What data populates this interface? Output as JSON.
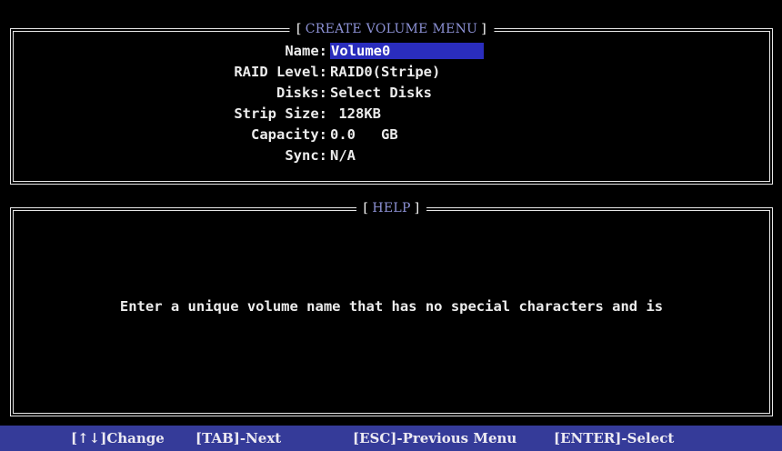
{
  "create_panel": {
    "title": "CREATE VOLUME MENU",
    "fields": [
      {
        "label": "Name:",
        "value": "Volume0"
      },
      {
        "label": "RAID Level:",
        "value": "RAID0(Stripe)"
      },
      {
        "label": "Disks:",
        "value": "Select Disks"
      },
      {
        "label": "Strip Size:",
        "value": " 128KB"
      },
      {
        "label": "Capacity:",
        "value": "0.0   GB"
      },
      {
        "label": "Sync:",
        "value": "N/A"
      }
    ]
  },
  "help_panel": {
    "title": "HELP",
    "text": "Enter a unique volume name that has no special characters and is"
  },
  "status_bar": {
    "hints": [
      "[↑↓]Change",
      "[TAB]-Next",
      "[ESC]-Previous Menu",
      "[ENTER]-Select"
    ]
  },
  "colors": {
    "background": "#000000",
    "panel_border": "#e8e8e8",
    "title_text": "#8d92d6",
    "selection_bg": "#2a2dbd",
    "status_bar_bg": "#353b99",
    "foreground": "#ececec"
  }
}
